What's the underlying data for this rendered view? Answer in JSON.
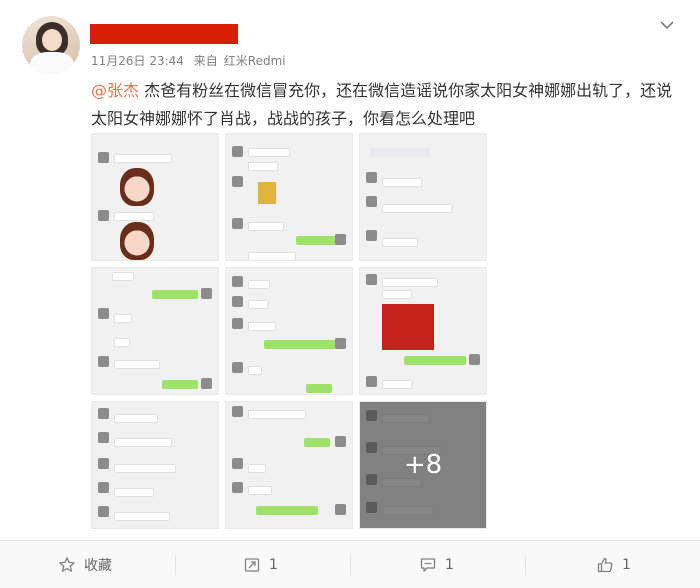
{
  "post": {
    "date": "11月26日 23:44",
    "from_label": "来自",
    "device": "红米Redmi",
    "mention": "@张杰",
    "body": " 杰爸有粉丝在微信冒充你，还在微信造谣说你家太阳女神娜娜出轨了，还说太阳女神娜娜怀了肖战，战战的孩子，你看怎么处理吧",
    "more_images_label": "+8"
  },
  "footer": {
    "favorite_label": "收藏",
    "repost_count": "1",
    "comment_count": "1",
    "like_count": "1"
  },
  "icons": [
    "user-avatar",
    "chevron-down-icon",
    "star-icon",
    "repost-icon",
    "comment-icon",
    "thumbs-up-icon"
  ]
}
